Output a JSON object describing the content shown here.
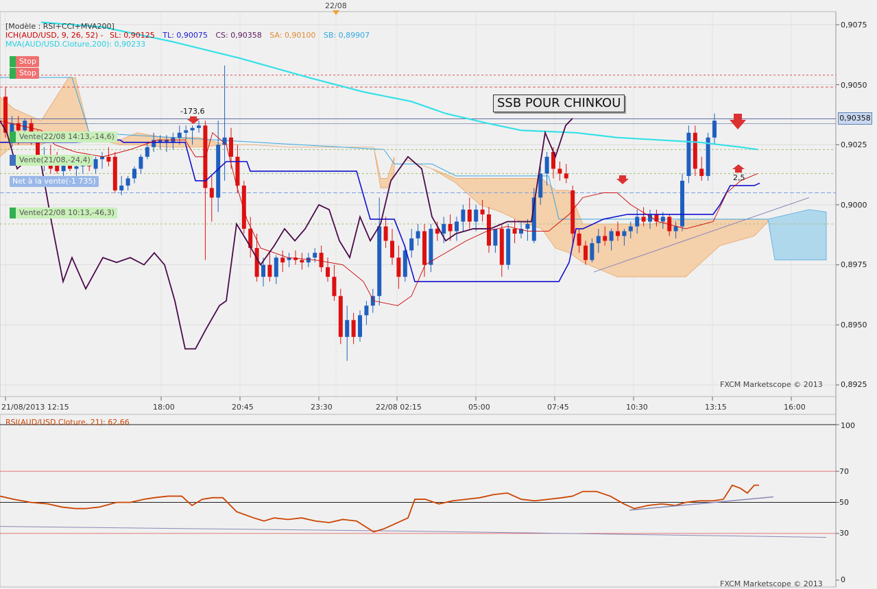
{
  "header": {
    "model": "[Modèle : RSI+CCI+MVA200]",
    "ich_name": "ICH(AUD/USD, 9, 26, 52) -",
    "sl": "SL: 0,90125",
    "tl": "TL: 0,90075",
    "cs": "CS: 0,90358",
    "sa": "SA: 0,90100",
    "sb": "SB: 0,89907",
    "mva": "MVA(AUD/USD.Cloture,200): 0,90233"
  },
  "top_marker": "22/08",
  "annotation_box": "SSB POUR CHINKOU",
  "trade_labels": {
    "label_173": "-173,6",
    "label_25": "2,5"
  },
  "tags": [
    {
      "text": "Stop",
      "color": "#f07070",
      "sq": "#30b050",
      "fg": "#ffffff"
    },
    {
      "text": "Stop",
      "color": "#f07070",
      "sq": "#30b050",
      "fg": "#ffffff"
    },
    {
      "text": "Vente(22/08 14:13,-14,6)",
      "color": "#c8f0b8",
      "sq": "#30b050",
      "fg": "#555555"
    },
    {
      "text": "Vente(21/08,-24,4)",
      "color": "#c8f0b8",
      "sq": "#4070c0",
      "fg": "#555555"
    },
    {
      "text": "Net à la vente(-1 735)",
      "color": "#9ab8e8",
      "sq": "#9ab8e8",
      "fg": "#ffffff"
    },
    {
      "text": "Vente(22/08 10:13,-46,3)",
      "color": "#c8f0b8",
      "sq": "#30b050",
      "fg": "#555555"
    }
  ],
  "watermark": "FXCM Marketscope © 2013",
  "rsi_label": "RSI(AUD/USD.Cloture, 21): 62,66",
  "colors": {
    "up": "#1f5fbf",
    "down": "#dd1111",
    "mva": "#33e0e8",
    "chikou": "#4a0a4a",
    "kijun": "#1010d0",
    "tenkan": "#cc0000",
    "cloud_bull": "#f5cda4",
    "cloud_bear": "#b0d8ec",
    "rsi": "#cc4400",
    "price_badge": "#c8d8f0"
  },
  "chart_data": [
    {
      "type": "candlestick",
      "title": "",
      "pair": "AUD/USD",
      "x_ticks": [
        "21/08/2013 12:15",
        "18:00",
        "20:45",
        "23:30",
        "22/08 02:15",
        "05:00",
        "07:45",
        "10:30",
        "13:15",
        "16:00"
      ],
      "y_ticks": [
        "0,9075",
        "0,9050",
        "0,9025",
        "0,9000",
        "0,8975",
        "0,8950",
        "0,8925"
      ],
      "ylim": [
        0.8921,
        0.9082
      ],
      "current_price": "0,90358",
      "indicators": [
        "Ichimoku(9,26,52)",
        "MVA(200)"
      ]
    },
    {
      "type": "line",
      "title": "RSI(AUD/USD.Cloture, 21): 62,66",
      "y_ticks": [
        "100",
        "70",
        "50",
        "30",
        "0"
      ],
      "ylim": [
        0,
        100
      ],
      "levels": [
        100,
        70,
        50,
        30
      ],
      "last_value": 62.66
    }
  ]
}
